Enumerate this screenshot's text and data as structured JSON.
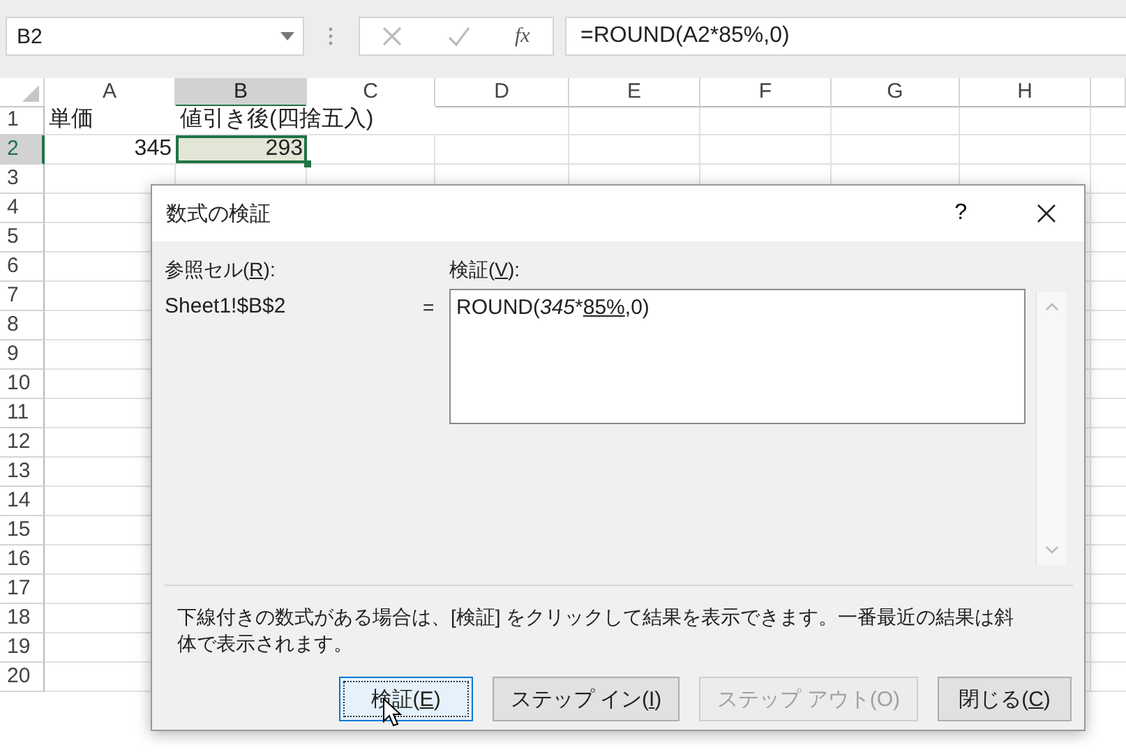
{
  "name_box": {
    "value": "B2"
  },
  "formula_bar": {
    "function_label": "fx",
    "formula": "=ROUND(A2*85%,0)"
  },
  "sheet": {
    "columns": [
      {
        "label": "A",
        "selected": false
      },
      {
        "label": "B",
        "selected": true
      },
      {
        "label": "C",
        "selected": false
      },
      {
        "label": "D",
        "selected": false
      },
      {
        "label": "E",
        "selected": false
      },
      {
        "label": "F",
        "selected": false
      },
      {
        "label": "G",
        "selected": false
      },
      {
        "label": "H",
        "selected": false
      }
    ],
    "rows": [
      {
        "label": "1",
        "selected": false,
        "cells": [
          {
            "text": "単価",
            "kind": "text",
            "selected": false
          },
          {
            "text": "値引き後(四捨五入)",
            "kind": "text",
            "selected": false
          }
        ]
      },
      {
        "label": "2",
        "selected": true,
        "cells": [
          {
            "text": "345",
            "kind": "number",
            "selected": false
          },
          {
            "text": "293",
            "kind": "number",
            "selected": true
          }
        ]
      },
      {
        "label": "3",
        "selected": false
      },
      {
        "label": "4",
        "selected": false
      },
      {
        "label": "5",
        "selected": false
      },
      {
        "label": "6",
        "selected": false
      },
      {
        "label": "7",
        "selected": false
      },
      {
        "label": "8",
        "selected": false
      },
      {
        "label": "9",
        "selected": false
      },
      {
        "label": "10",
        "selected": false
      },
      {
        "label": "11",
        "selected": false
      },
      {
        "label": "12",
        "selected": false
      },
      {
        "label": "13",
        "selected": false
      },
      {
        "label": "14",
        "selected": false
      },
      {
        "label": "15",
        "selected": false
      },
      {
        "label": "16",
        "selected": false
      },
      {
        "label": "17",
        "selected": false
      },
      {
        "label": "18",
        "selected": false
      },
      {
        "label": "19",
        "selected": false
      },
      {
        "label": "20",
        "selected": false
      }
    ]
  },
  "dialog": {
    "title": "数式の検証",
    "help": "?",
    "reference_label": {
      "before": "参照セル(",
      "key": "R",
      "after": "):"
    },
    "reference": "Sheet1!$B$2",
    "equals": "=",
    "evaluation_label": {
      "before": "検証(",
      "key": "V",
      "after": "):"
    },
    "evaluation": [
      {
        "text": "ROUND(",
        "kind": "plain"
      },
      {
        "text": "345",
        "kind": "italic"
      },
      {
        "text": "*",
        "kind": "plain"
      },
      {
        "text": "85%",
        "kind": "underline"
      },
      {
        "text": ",0)",
        "kind": "plain"
      }
    ],
    "note": "下線付きの数式がある場合は、[検証] をクリックして結果を表示できます。一番最近の結果は斜体で表示されます。",
    "buttons": [
      {
        "before": "検証(",
        "key": "E",
        "after": ")",
        "focused": true,
        "disabled": false
      },
      {
        "before": "ステップ イン(",
        "key": "I",
        "after": ")",
        "focused": false,
        "disabled": false
      },
      {
        "before": "ステップ アウト(",
        "key": "O",
        "after": ")",
        "focused": false,
        "disabled": true
      },
      {
        "before": "閉じる(",
        "key": "C",
        "after": ")",
        "focused": false,
        "disabled": false
      }
    ]
  }
}
